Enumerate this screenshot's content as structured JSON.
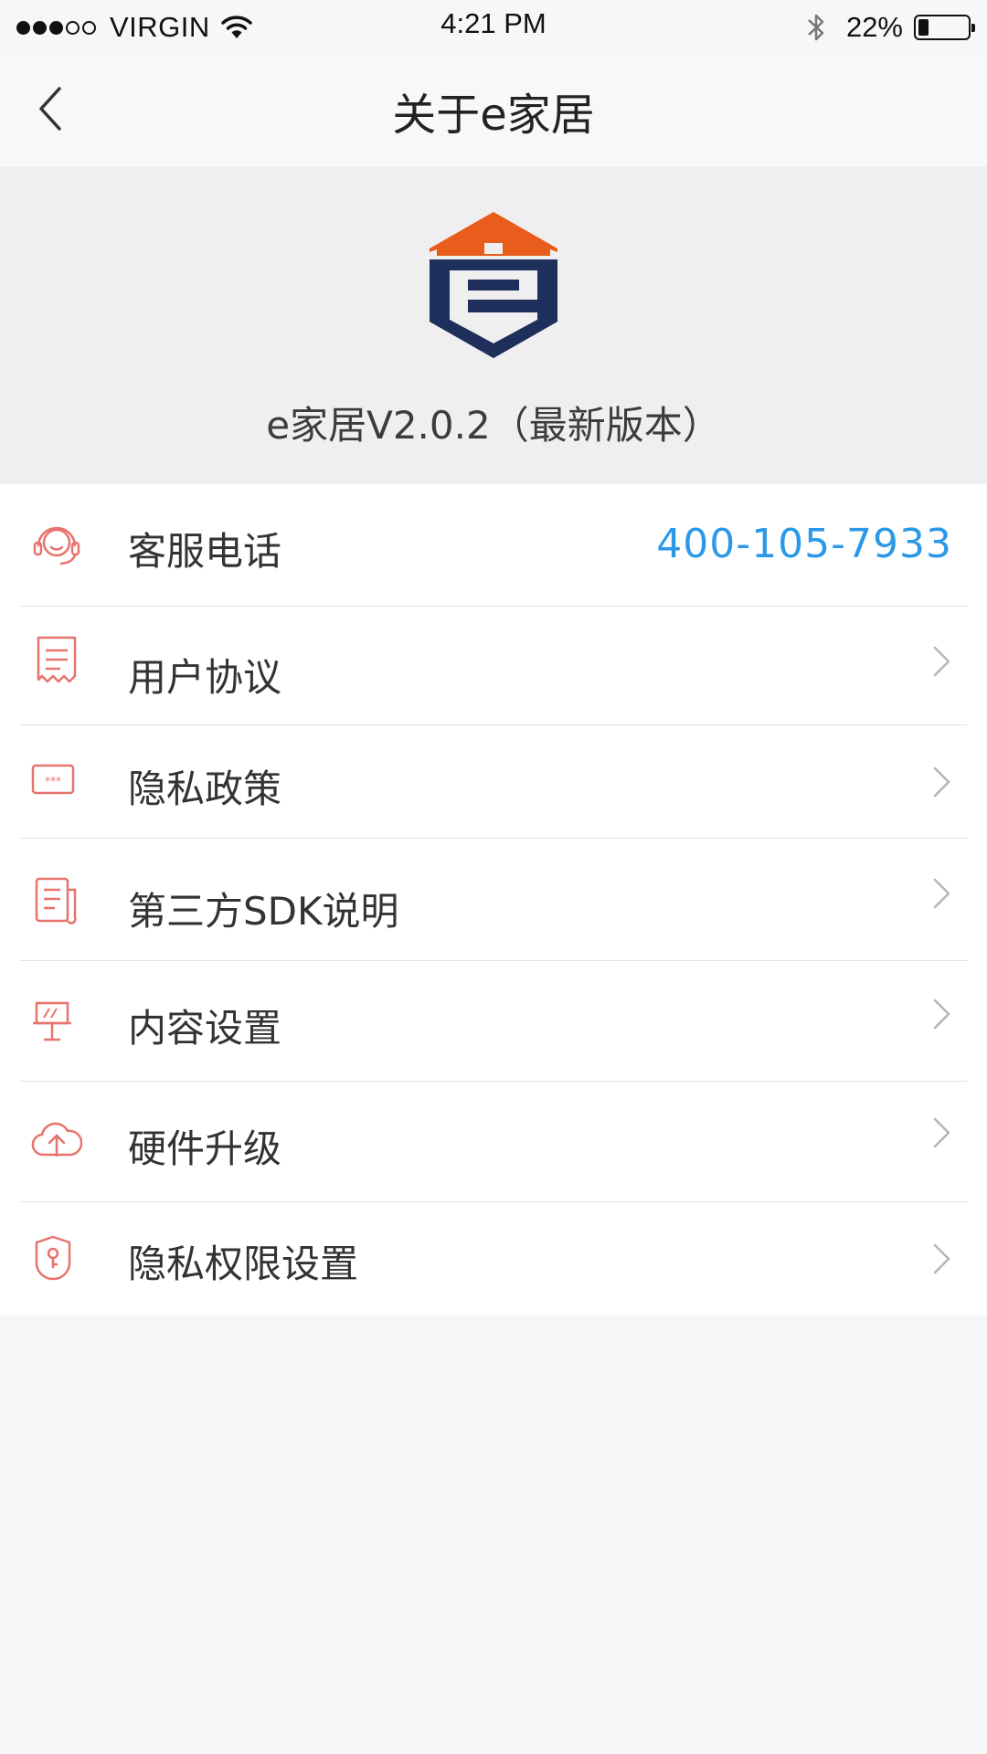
{
  "status_bar": {
    "carrier": "VIRGIN",
    "time": "4:21 PM",
    "battery": "22%",
    "battery_level": 0.22,
    "signal_bars_filled": 3,
    "signal_bars_total": 5
  },
  "nav": {
    "title": "关于e家居",
    "back_icon": "chevron-left-icon"
  },
  "header": {
    "logo": "e-home-logo",
    "version": "e家居V2.0.2（最新版本）"
  },
  "menu": [
    {
      "label": "客服电话",
      "value": "400-105-7933",
      "icon": "headset-icon"
    },
    {
      "label": "用户协议",
      "icon": "receipt-icon"
    },
    {
      "label": "隐私政策",
      "icon": "password-icon"
    },
    {
      "label": "第三方SDK说明",
      "icon": "document-icon"
    },
    {
      "label": "内容设置",
      "icon": "easel-icon"
    },
    {
      "label": "硬件升级",
      "icon": "cloud-upload-icon"
    },
    {
      "label": "隐私权限设置",
      "icon": "shield-key-icon"
    }
  ],
  "colors": {
    "accent_icon": "#e8726c",
    "phone_link": "#2c99e8",
    "logo_orange": "#e85d1c",
    "logo_navy": "#1e2f5c",
    "background": "#f6f6f6"
  }
}
